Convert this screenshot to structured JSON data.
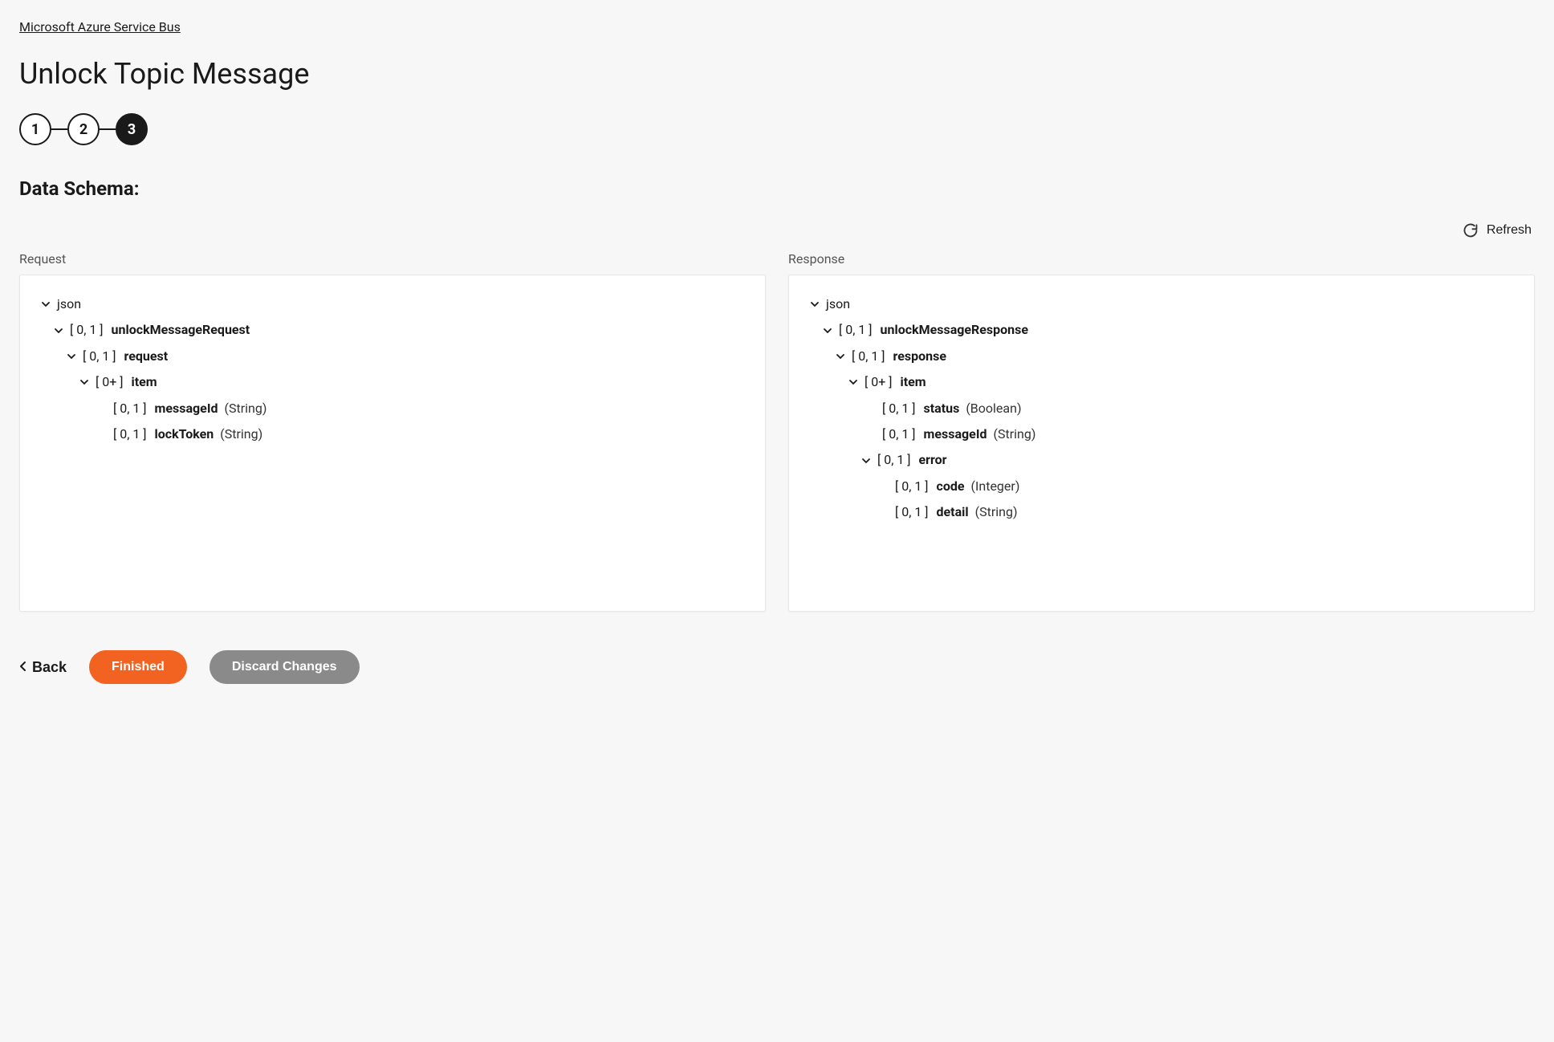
{
  "breadcrumb": {
    "label": "Microsoft Azure Service Bus"
  },
  "page_title": "Unlock Topic Message",
  "stepper": {
    "steps": [
      "1",
      "2",
      "3"
    ],
    "active_index": 2
  },
  "section_heading": "Data Schema:",
  "refresh": {
    "label": "Refresh"
  },
  "column_labels": {
    "request": "Request",
    "response": "Response"
  },
  "request_tree": [
    {
      "indent": 0,
      "expandable": true,
      "label": "json"
    },
    {
      "indent": 1,
      "expandable": true,
      "card": "[ 0, 1 ]",
      "name": "unlockMessageRequest"
    },
    {
      "indent": 2,
      "expandable": true,
      "card": "[ 0, 1 ]",
      "name": "request"
    },
    {
      "indent": 3,
      "expandable": true,
      "card": "[ 0+ ]",
      "name": "item"
    },
    {
      "indent": 4,
      "expandable": false,
      "card": "[ 0, 1 ]",
      "name": "messageId",
      "type": "(String)"
    },
    {
      "indent": 4,
      "expandable": false,
      "card": "[ 0, 1 ]",
      "name": "lockToken",
      "type": "(String)"
    }
  ],
  "response_tree": [
    {
      "indent": 0,
      "expandable": true,
      "label": "json"
    },
    {
      "indent": 1,
      "expandable": true,
      "card": "[ 0, 1 ]",
      "name": "unlockMessageResponse"
    },
    {
      "indent": 2,
      "expandable": true,
      "card": "[ 0, 1 ]",
      "name": "response"
    },
    {
      "indent": 3,
      "expandable": true,
      "card": "[ 0+ ]",
      "name": "item"
    },
    {
      "indent": 4,
      "expandable": false,
      "card": "[ 0, 1 ]",
      "name": "status",
      "type": "(Boolean)"
    },
    {
      "indent": 4,
      "expandable": false,
      "card": "[ 0, 1 ]",
      "name": "messageId",
      "type": "(String)"
    },
    {
      "indent": 4,
      "expandable": true,
      "card": "[ 0, 1 ]",
      "name": "error"
    },
    {
      "indent": 5,
      "expandable": false,
      "card": "[ 0, 1 ]",
      "name": "code",
      "type": "(Integer)"
    },
    {
      "indent": 5,
      "expandable": false,
      "card": "[ 0, 1 ]",
      "name": "detail",
      "type": "(String)"
    }
  ],
  "footer": {
    "back": "Back",
    "finished": "Finished",
    "discard": "Discard Changes"
  }
}
